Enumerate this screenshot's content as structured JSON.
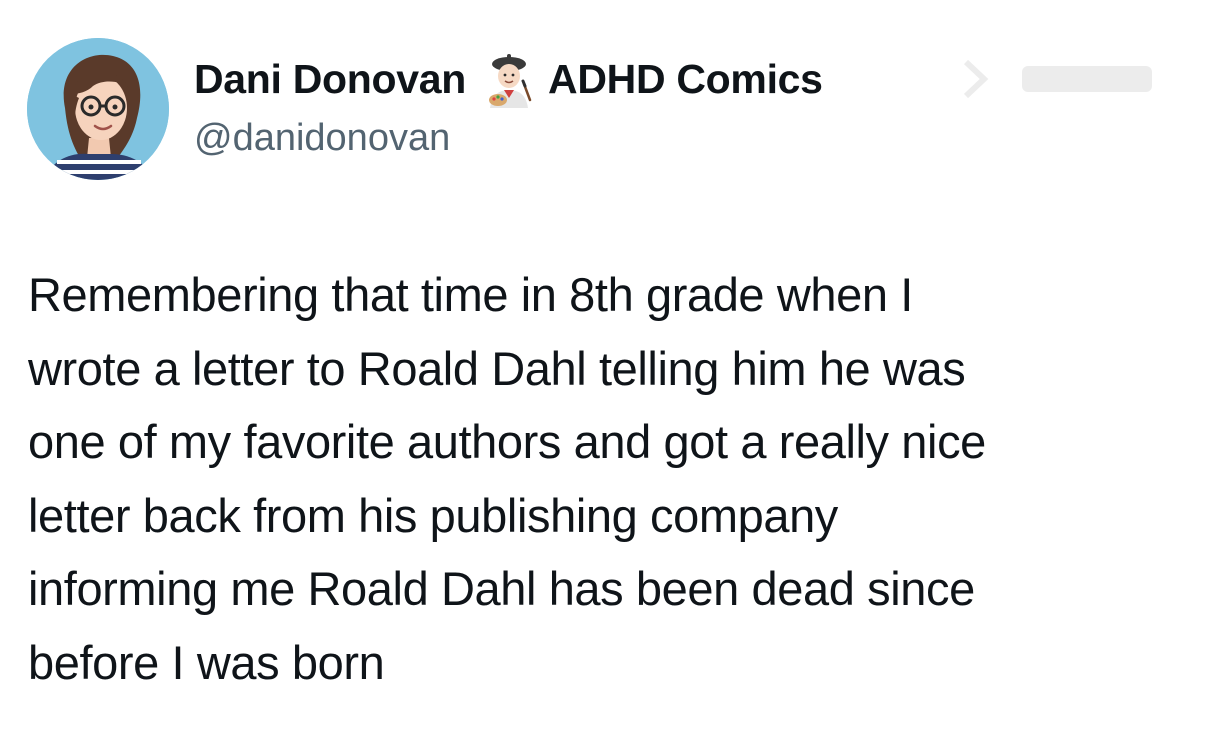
{
  "tweet": {
    "author": {
      "display_name": "Dani Donovan",
      "emoji": "artist-emoji",
      "name_suffix": "ADHD Comics",
      "handle": "@danidonovan",
      "avatar": "avatar-cartoon-portrait"
    },
    "text_lines": [
      "Remembering that time in 8th grade when I",
      "wrote a letter to Roald Dahl telling him he was",
      "one of my favorite authors and got a really nice",
      "letter back from his publishing company",
      "informing me Roald Dahl has been dead since",
      "before I was born"
    ]
  },
  "colors": {
    "text_primary": "#0f1419",
    "text_secondary": "#536471",
    "background": "#ffffff",
    "avatar_background": "#7fc3e0"
  }
}
